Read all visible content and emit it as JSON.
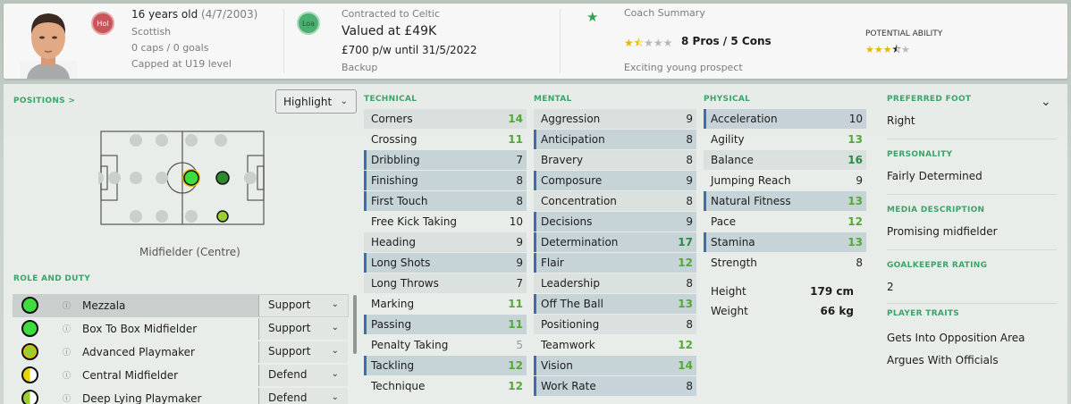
{
  "header": {
    "age": "16 years old",
    "dob": "(4/7/2003)",
    "nationality": "Scottish",
    "caps": "0 caps / 0 goals",
    "capped_at": "Capped at U19 level",
    "hol_badge": "Hol",
    "loa_badge": "Loa",
    "contract": "Contracted to Celtic",
    "value": "Valued at £49K",
    "wage": "£700 p/w until 31/5/2022",
    "status": "Backup",
    "coach_summary_title": "Coach Summary",
    "coach_pros_cons": "8 Pros / 5 Cons",
    "coach_tagline": "Exciting young prospect",
    "coach_stars": 1.5,
    "potential_label": "POTENTIAL ABILITY",
    "potential_stars": 3.5
  },
  "left": {
    "positions_label": "POSITIONS >",
    "highlight_label": "Highlight",
    "position_caption": "Midfielder (Centre)",
    "role_duty_label": "ROLE AND DUTY",
    "roles": [
      {
        "name": "Mezzala",
        "duty": "Support",
        "selected": true,
        "dot": "full"
      },
      {
        "name": "Box To Box Midfielder",
        "duty": "Support",
        "selected": false,
        "dot": "full"
      },
      {
        "name": "Advanced Playmaker",
        "duty": "Support",
        "selected": false,
        "dot": "ring"
      },
      {
        "name": "Central Midfielder",
        "duty": "Defend",
        "selected": false,
        "dot": "half"
      },
      {
        "name": "Deep Lying Playmaker",
        "duty": "Defend",
        "selected": false,
        "dot": "half"
      }
    ]
  },
  "technical": {
    "label": "TECHNICAL",
    "rows": [
      {
        "name": "Corners",
        "value": "14",
        "hl": false,
        "color": "green"
      },
      {
        "name": "Crossing",
        "value": "11",
        "hl": false,
        "color": "green"
      },
      {
        "name": "Dribbling",
        "value": "7",
        "hl": true,
        "color": "dark"
      },
      {
        "name": "Finishing",
        "value": "8",
        "hl": true,
        "color": "dark"
      },
      {
        "name": "First Touch",
        "value": "8",
        "hl": true,
        "color": "dark"
      },
      {
        "name": "Free Kick Taking",
        "value": "10",
        "hl": false,
        "color": "dark"
      },
      {
        "name": "Heading",
        "value": "9",
        "hl": false,
        "color": "dark"
      },
      {
        "name": "Long Shots",
        "value": "9",
        "hl": true,
        "color": "dark"
      },
      {
        "name": "Long Throws",
        "value": "7",
        "hl": false,
        "color": "dark"
      },
      {
        "name": "Marking",
        "value": "11",
        "hl": false,
        "color": "green"
      },
      {
        "name": "Passing",
        "value": "11",
        "hl": true,
        "color": "green"
      },
      {
        "name": "Penalty Taking",
        "value": "5",
        "hl": false,
        "color": "grey"
      },
      {
        "name": "Tackling",
        "value": "12",
        "hl": true,
        "color": "green"
      },
      {
        "name": "Technique",
        "value": "12",
        "hl": false,
        "color": "green"
      }
    ]
  },
  "mental": {
    "label": "MENTAL",
    "rows": [
      {
        "name": "Aggression",
        "value": "9",
        "hl": false,
        "color": "dark"
      },
      {
        "name": "Anticipation",
        "value": "8",
        "hl": true,
        "color": "dark"
      },
      {
        "name": "Bravery",
        "value": "8",
        "hl": false,
        "color": "dark"
      },
      {
        "name": "Composure",
        "value": "9",
        "hl": true,
        "color": "dark"
      },
      {
        "name": "Concentration",
        "value": "8",
        "hl": false,
        "color": "dark"
      },
      {
        "name": "Decisions",
        "value": "9",
        "hl": true,
        "color": "dark"
      },
      {
        "name": "Determination",
        "value": "17",
        "hl": true,
        "color": "dgreen"
      },
      {
        "name": "Flair",
        "value": "12",
        "hl": true,
        "color": "green"
      },
      {
        "name": "Leadership",
        "value": "8",
        "hl": false,
        "color": "dark"
      },
      {
        "name": "Off The Ball",
        "value": "13",
        "hl": true,
        "color": "green"
      },
      {
        "name": "Positioning",
        "value": "8",
        "hl": false,
        "color": "dark"
      },
      {
        "name": "Teamwork",
        "value": "12",
        "hl": false,
        "color": "green"
      },
      {
        "name": "Vision",
        "value": "14",
        "hl": true,
        "color": "green"
      },
      {
        "name": "Work Rate",
        "value": "8",
        "hl": true,
        "color": "dark"
      }
    ]
  },
  "physical": {
    "label": "PHYSICAL",
    "rows": [
      {
        "name": "Acceleration",
        "value": "10",
        "hl": true,
        "color": "dark"
      },
      {
        "name": "Agility",
        "value": "13",
        "hl": false,
        "color": "green"
      },
      {
        "name": "Balance",
        "value": "16",
        "hl": false,
        "color": "dgreen"
      },
      {
        "name": "Jumping Reach",
        "value": "9",
        "hl": false,
        "color": "dark"
      },
      {
        "name": "Natural Fitness",
        "value": "13",
        "hl": true,
        "color": "green"
      },
      {
        "name": "Pace",
        "value": "12",
        "hl": false,
        "color": "green"
      },
      {
        "name": "Stamina",
        "value": "13",
        "hl": true,
        "color": "green"
      },
      {
        "name": "Strength",
        "value": "8",
        "hl": false,
        "color": "dark"
      }
    ],
    "height_label": "Height",
    "height_value": "179 cm",
    "weight_label": "Weight",
    "weight_value": "66 kg"
  },
  "info": {
    "preferred_foot_label": "PREFERRED FOOT",
    "preferred_foot": "Right",
    "personality_label": "PERSONALITY",
    "personality": "Fairly Determined",
    "media_label": "MEDIA DESCRIPTION",
    "media": "Promising midfielder",
    "gk_label": "GOALKEEPER RATING",
    "gk": "2",
    "traits_label": "PLAYER TRAITS",
    "traits": [
      "Gets Into Opposition Area",
      "Argues With Officials"
    ]
  }
}
